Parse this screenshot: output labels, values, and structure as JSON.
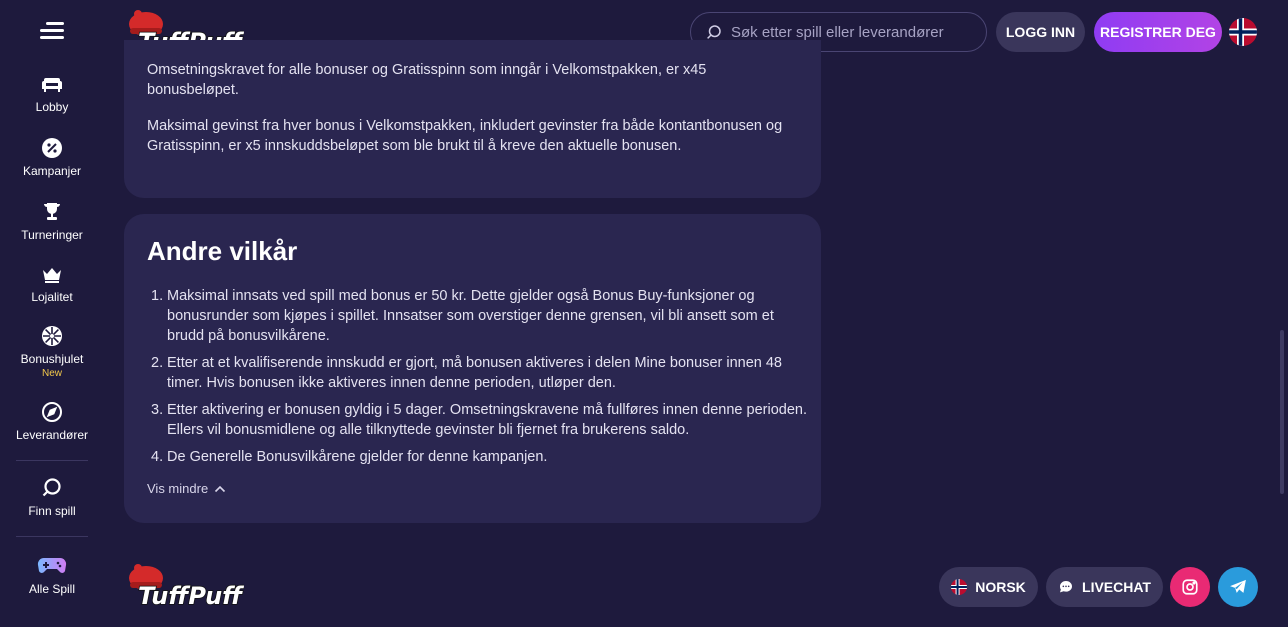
{
  "sidebar": {
    "items": [
      {
        "label": "Lobby",
        "icon": "armchair-icon"
      },
      {
        "label": "Kampanjer",
        "icon": "percent-badge-icon"
      },
      {
        "label": "Turneringer",
        "icon": "trophy-icon"
      },
      {
        "label": "Lojalitet",
        "icon": "crown-icon"
      },
      {
        "label": "Bonushjulet",
        "icon": "wheel-icon",
        "badge": "New"
      },
      {
        "label": "Leverandører",
        "icon": "compass-icon"
      },
      {
        "label": "Finn spill",
        "icon": "search-icon"
      },
      {
        "label": "Alle Spill",
        "icon": "gamepad-icon"
      }
    ]
  },
  "header": {
    "logo_text": "TuffPuff",
    "search_placeholder": "Søk etter spill eller leverandører",
    "login_label": "LOGG INN",
    "register_label": "REGISTRER DEG"
  },
  "welcome_card": {
    "p1": "Omsetningskravet for alle bonuser og Gratisspinn som inngår i Velkomstpakken, er x45 bonusbeløpet.",
    "p2": "Maksimal gevinst fra hver bonus i Velkomstpakken, inkludert gevinster fra både kontantbonusen og Gratisspinn, er x5 innskuddsbeløpet som ble brukt til å kreve den aktuelle bonusen."
  },
  "terms_card": {
    "title": "Andre vilkår",
    "items": [
      "Maksimal innsats ved spill med bonus er 50 kr. Dette gjelder også Bonus Buy-funksjoner og bonusrunder som kjøpes i spillet. Innsatser som overstiger denne grensen, vil bli ansett som et brudd på bonusvilkårene.",
      "Etter at et kvalifiserende innskudd er gjort, må bonusen aktiveres i delen Mine bonuser innen 48 timer. Hvis bonusen ikke aktiveres innen denne perioden, utløper den.",
      "Etter aktivering er bonusen gyldig i 5 dager. Omsetningskravene må fullføres innen denne perioden. Ellers vil bonusmidlene og alle tilknyttede gevinster bli fjernet fra brukerens saldo.",
      "De Generelle Bonusvilkårene gjelder for denne kampanjen."
    ],
    "show_less": "Vis mindre"
  },
  "footer": {
    "language_label": "NORSK",
    "livechat_label": "LIVECHAT"
  },
  "colors": {
    "background": "#1e1a3d",
    "card": "#2a2650",
    "accent": "#9b3ff0",
    "instagram": "#e92a74",
    "telegram": "#2a9bdc"
  }
}
